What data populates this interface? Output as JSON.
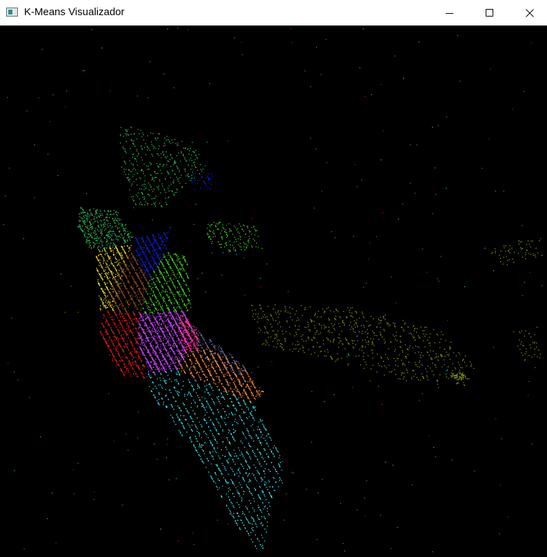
{
  "window": {
    "title": "K-Means Visualizador",
    "icon": "app-window-icon",
    "controls": [
      "minimize-icon",
      "maximize-icon",
      "close-icon"
    ]
  },
  "visualization": {
    "background": "#000000",
    "cluster_colors": {
      "green_light": "#2fbf5a",
      "blue": "#1020d8",
      "yellow": "#f0e020",
      "brown": "#8a4a20",
      "lime": "#40d020",
      "red": "#e01818",
      "magenta": "#c040f0",
      "pink": "#ff3090",
      "olive": "#8a9a10",
      "orange": "#ff8c30",
      "slate": "#6a6aa0",
      "cyan": "#30e8f0",
      "teal_green": "#40c080"
    }
  }
}
